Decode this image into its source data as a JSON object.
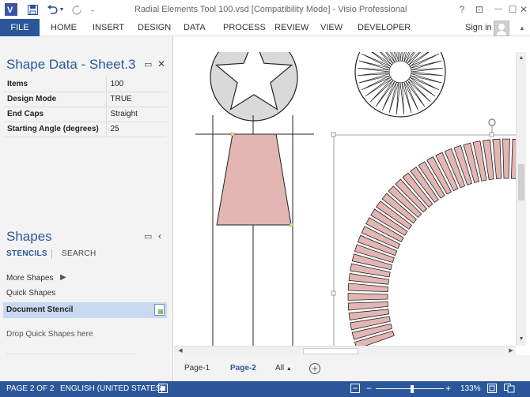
{
  "app": {
    "title": "Radial Elements Tool 100.vsd  [Compatibility Mode] - Visio Professional",
    "logo": "V",
    "window_controls": {
      "help": "?",
      "restore_ribbon": "⊡",
      "minimize": "—",
      "maximize": "☐",
      "close": "✕"
    },
    "qat": {
      "save_icon": "floppy-icon",
      "undo_icon": "undo-icon",
      "redo_icon": "redo-icon",
      "customize_icon": "customize-icon"
    }
  },
  "ribbon": {
    "file": "FILE",
    "tabs": [
      "HOME",
      "INSERT",
      "DESIGN",
      "DATA",
      "PROCESS",
      "REVIEW",
      "VIEW",
      "DEVELOPER"
    ],
    "sign_in": "Sign in"
  },
  "shape_data": {
    "title": "Shape Data - Sheet.3",
    "rows": [
      {
        "key": "Items",
        "value": "100"
      },
      {
        "key": "Design Mode",
        "value": "TRUE"
      },
      {
        "key": "End Caps",
        "value": "Straight"
      },
      {
        "key": "Starting Angle (degrees)",
        "value": "25"
      }
    ]
  },
  "shapes": {
    "title": "Shapes",
    "tabs": {
      "stencils": "STENCILS",
      "search": "SEARCH"
    },
    "more_shapes": "More Shapes",
    "quick_shapes": "Quick Shapes",
    "document_stencil": "Document Stencil",
    "drop_hint": "Drop Quick Shapes here"
  },
  "pages": {
    "tabs": [
      "Page-1",
      "Page-2"
    ],
    "active": "Page-2",
    "all": "All"
  },
  "status": {
    "page": "PAGE 2 OF 2",
    "language": "ENGLISH (UNITED STATES)",
    "zoom": "133%",
    "zoom_level_percent": 133
  },
  "colors": {
    "accent": "#2b579a",
    "shape_fill": "#e3b5b3",
    "shape_gray": "#d9d9d9",
    "selection_handle": "#f0e26a"
  }
}
